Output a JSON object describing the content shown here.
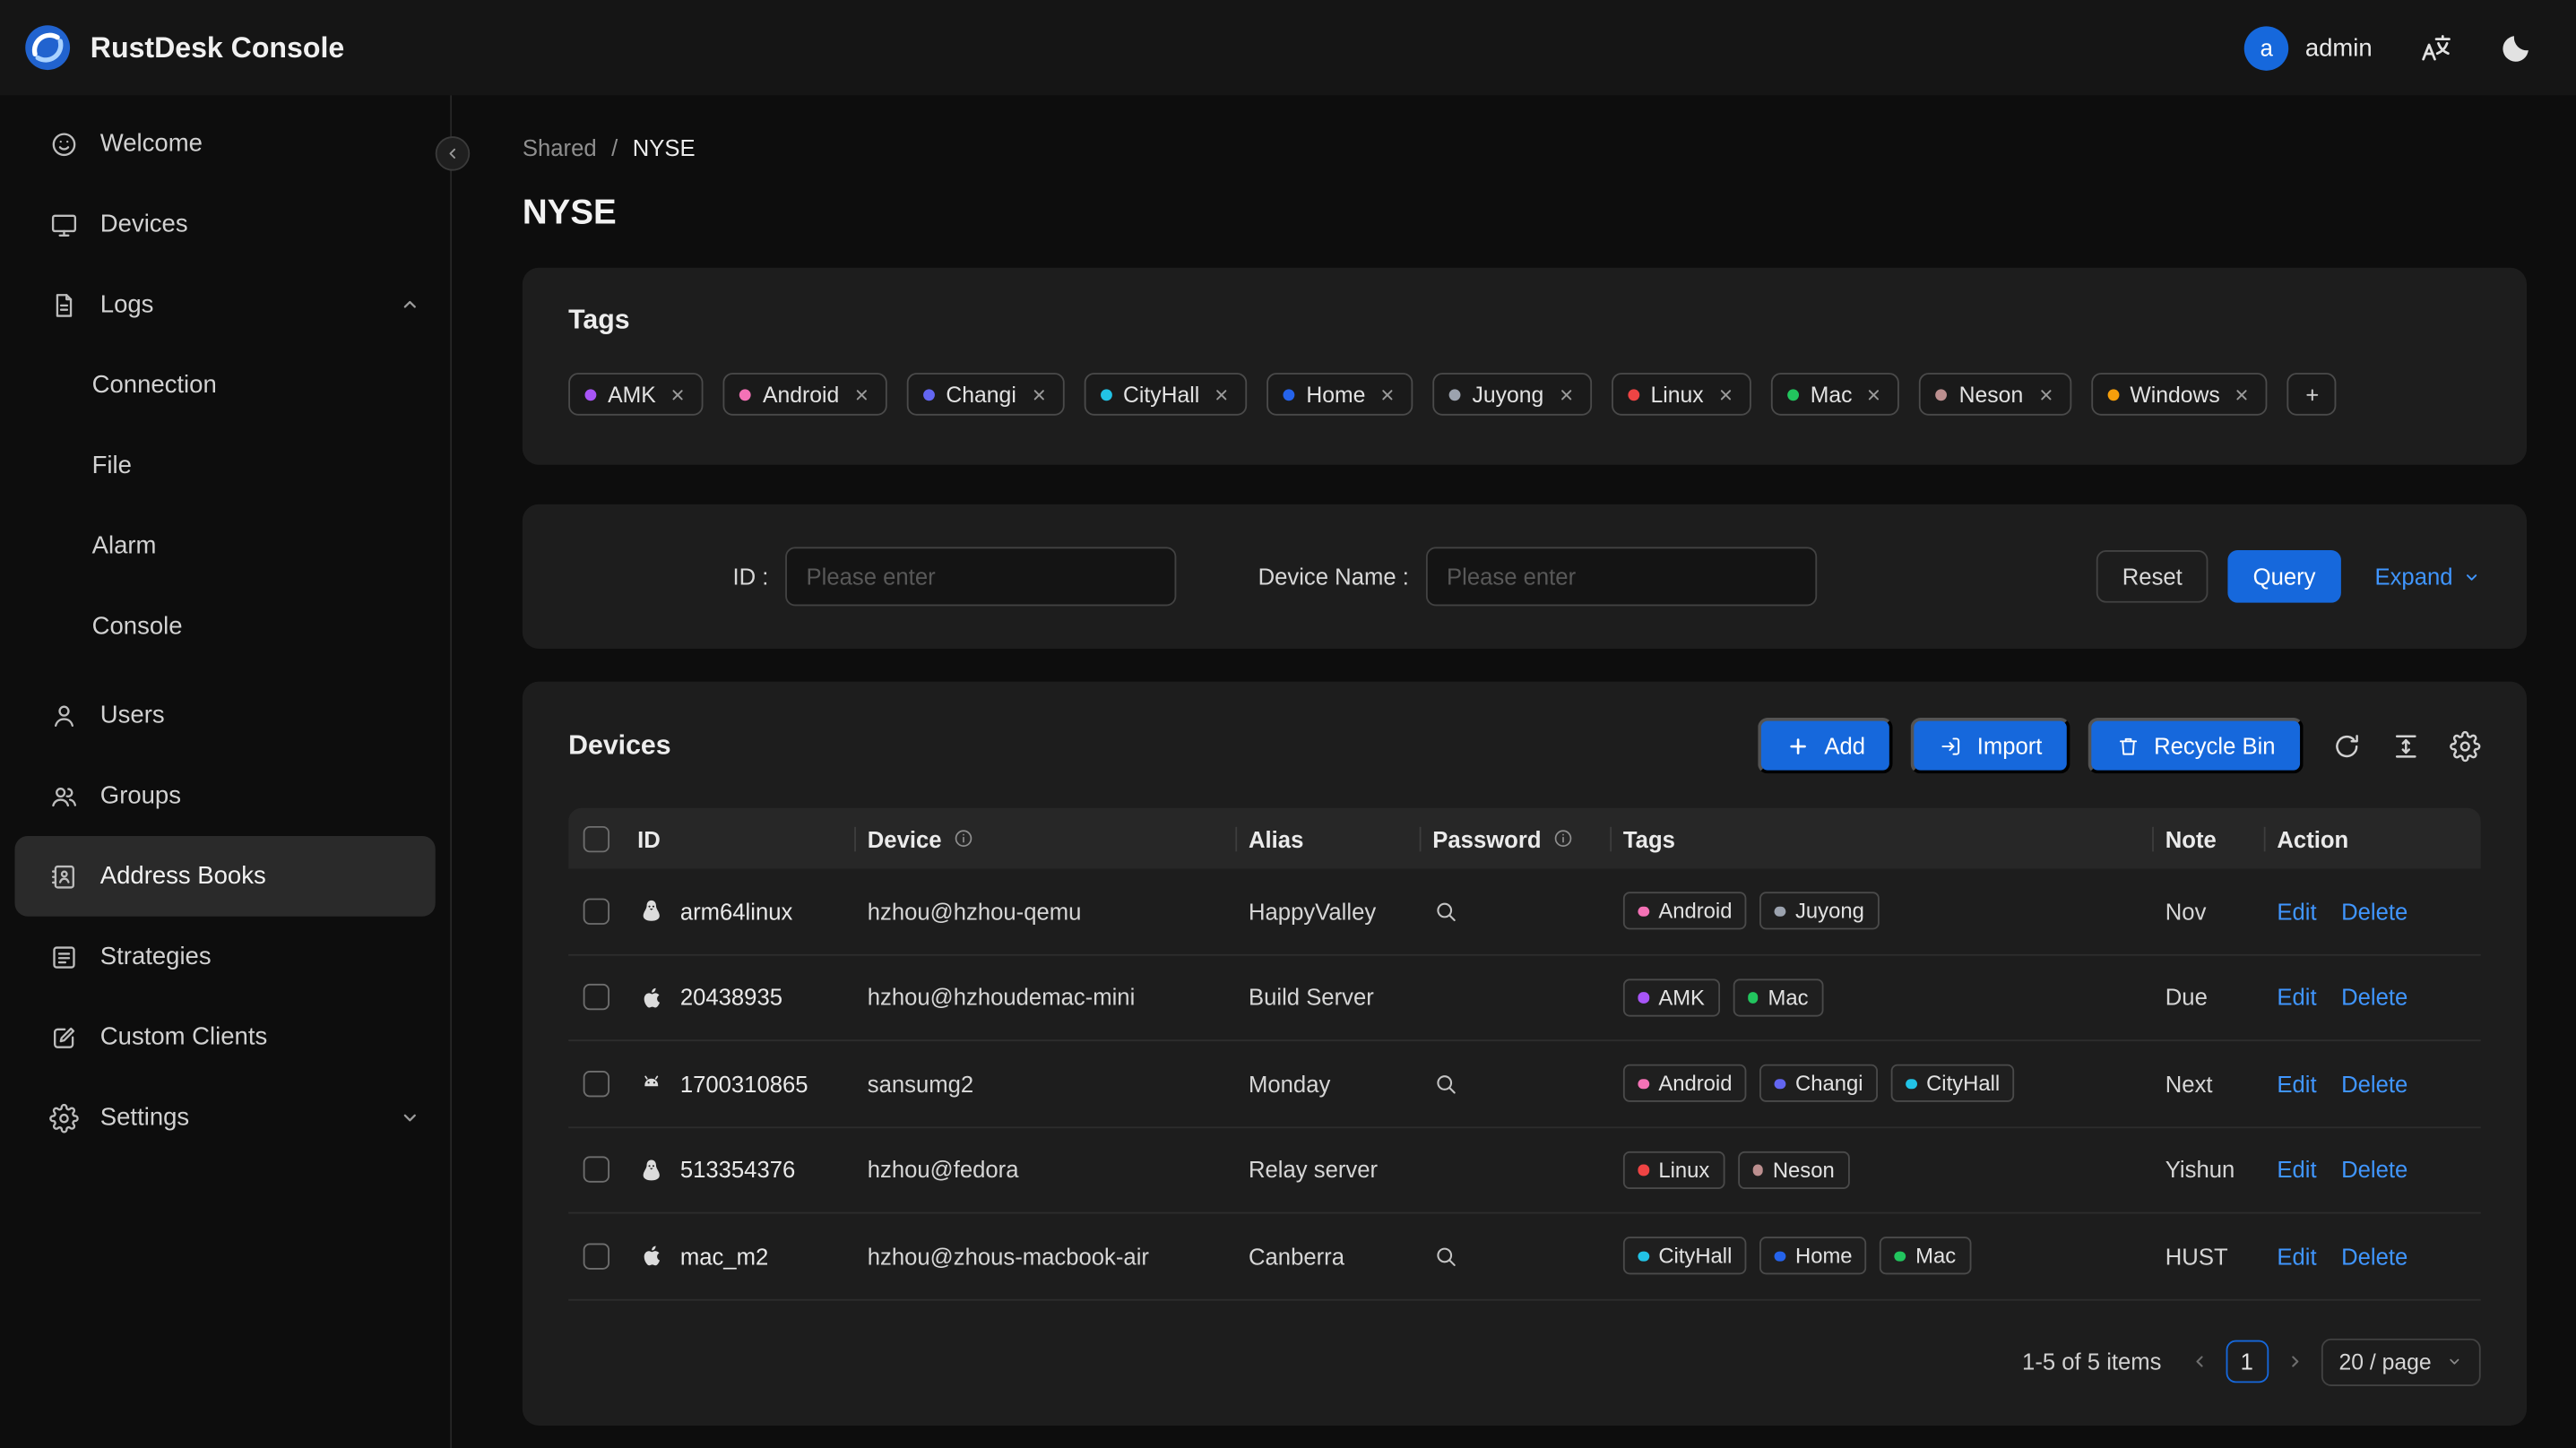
{
  "app": {
    "title": "RustDesk Console"
  },
  "header": {
    "user": {
      "avatar_letter": "a",
      "name": "admin"
    }
  },
  "colors": {
    "accent": "#1668dc",
    "link": "#4096ff"
  },
  "sidebar": {
    "items": [
      {
        "label": "Welcome"
      },
      {
        "label": "Devices"
      },
      {
        "label": "Logs"
      },
      {
        "label": "Connection"
      },
      {
        "label": "File"
      },
      {
        "label": "Alarm"
      },
      {
        "label": "Console"
      },
      {
        "label": "Users"
      },
      {
        "label": "Groups"
      },
      {
        "label": "Address Books"
      },
      {
        "label": "Strategies"
      },
      {
        "label": "Custom Clients"
      },
      {
        "label": "Settings"
      }
    ]
  },
  "breadcrumb": {
    "parent": "Shared",
    "separator": "/",
    "current": "NYSE"
  },
  "page": {
    "title": "NYSE"
  },
  "tags_card": {
    "title": "Tags",
    "add_label": "+",
    "tags": [
      {
        "label": "AMK",
        "color": "#a855f7"
      },
      {
        "label": "Android",
        "color": "#f472b6"
      },
      {
        "label": "Changi",
        "color": "#6366f1"
      },
      {
        "label": "CityHall",
        "color": "#22c3e6"
      },
      {
        "label": "Home",
        "color": "#2563eb"
      },
      {
        "label": "Juyong",
        "color": "#9ca3af"
      },
      {
        "label": "Linux",
        "color": "#ef4444"
      },
      {
        "label": "Mac",
        "color": "#22c55e"
      },
      {
        "label": "Neson",
        "color": "#bc8f8f"
      },
      {
        "label": "Windows",
        "color": "#f59e0b"
      }
    ]
  },
  "filter": {
    "id_label": "ID :",
    "device_label": "Device Name :",
    "placeholder": "Please enter",
    "reset_label": "Reset",
    "query_label": "Query",
    "expand_label": "Expand"
  },
  "devices": {
    "title": "Devices",
    "toolbar": {
      "add_label": "Add",
      "import_label": "Import",
      "recycle_label": "Recycle Bin"
    },
    "actions": {
      "edit": "Edit",
      "delete": "Delete"
    },
    "table": {
      "columns": {
        "id": "ID",
        "device": "Device",
        "alias": "Alias",
        "password": "Password",
        "tags": "Tags",
        "note": "Note",
        "action": "Action"
      },
      "rows": [
        {
          "os": "linux",
          "id": "arm64linux",
          "device": "hzhou@hzhou-qemu",
          "alias": "HappyValley",
          "has_password": true,
          "tags": [
            {
              "label": "Android",
              "color": "#f472b6"
            },
            {
              "label": "Juyong",
              "color": "#9ca3af"
            }
          ],
          "note": "Nov"
        },
        {
          "os": "apple",
          "id": "20438935",
          "device": "hzhou@hzhoudemac-mini",
          "alias": "Build Server",
          "has_password": false,
          "tags": [
            {
              "label": "AMK",
              "color": "#a855f7"
            },
            {
              "label": "Mac",
              "color": "#22c55e"
            }
          ],
          "note": "Due"
        },
        {
          "os": "android",
          "id": "1700310865",
          "device": "sansumg2",
          "alias": "Monday",
          "has_password": true,
          "tags": [
            {
              "label": "Android",
              "color": "#f472b6"
            },
            {
              "label": "Changi",
              "color": "#6366f1"
            },
            {
              "label": "CityHall",
              "color": "#22c3e6"
            }
          ],
          "note": "Next"
        },
        {
          "os": "linux",
          "id": "513354376",
          "device": "hzhou@fedora",
          "alias": "Relay server",
          "has_password": false,
          "tags": [
            {
              "label": "Linux",
              "color": "#ef4444"
            },
            {
              "label": "Neson",
              "color": "#bc8f8f"
            }
          ],
          "note": "Yishun"
        },
        {
          "os": "apple",
          "id": "mac_m2",
          "device": "hzhou@zhous-macbook-air",
          "alias": "Canberra",
          "has_password": true,
          "tags": [
            {
              "label": "CityHall",
              "color": "#22c3e6"
            },
            {
              "label": "Home",
              "color": "#2563eb"
            },
            {
              "label": "Mac",
              "color": "#22c55e"
            }
          ],
          "note": "HUST"
        }
      ]
    },
    "pagination": {
      "total_text": "1-5 of 5 items",
      "current": "1",
      "page_size": "20 / page"
    }
  }
}
